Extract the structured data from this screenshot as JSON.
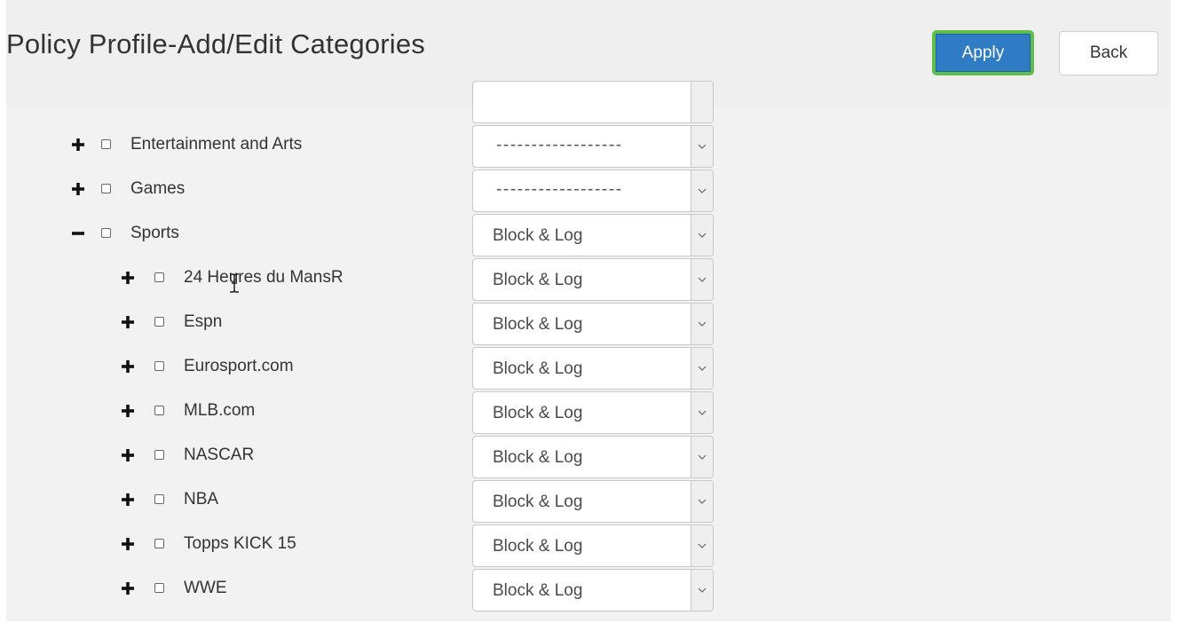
{
  "header": {
    "title": "Policy Profile-Add/Edit Categories",
    "apply_label": "Apply",
    "back_label": "Back"
  },
  "colors": {
    "apply_bg": "#2f7bc4",
    "apply_focus_ring": "#5fbf4a",
    "panel_bg": "#f2f2f2"
  },
  "categories": [
    {
      "label": "Entertainment and Arts",
      "expander": "plus-icon",
      "action": "------------------"
    },
    {
      "label": "Games",
      "expander": "plus-icon",
      "action": "------------------"
    },
    {
      "label": "Sports",
      "expander": "minus-icon",
      "action": "Block & Log"
    },
    {
      "label": "24 Heures du MansR",
      "expander": "plus-icon",
      "action": "Block & Log"
    },
    {
      "label": "Espn",
      "expander": "plus-icon",
      "action": "Block & Log"
    },
    {
      "label": "Eurosport.com",
      "expander": "plus-icon",
      "action": "Block & Log"
    },
    {
      "label": "MLB.com",
      "expander": "plus-icon",
      "action": "Block & Log"
    },
    {
      "label": "NASCAR",
      "expander": "plus-icon",
      "action": "Block & Log"
    },
    {
      "label": "NBA",
      "expander": "plus-icon",
      "action": "Block & Log"
    },
    {
      "label": "Topps KICK 15",
      "expander": "plus-icon",
      "action": "Block & Log"
    },
    {
      "label": "WWE",
      "expander": "plus-icon",
      "action": "Block & Log"
    }
  ]
}
